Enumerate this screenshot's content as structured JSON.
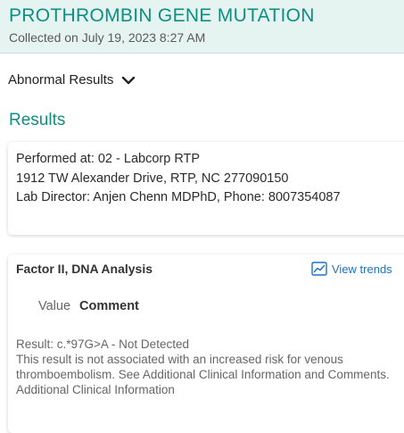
{
  "header": {
    "title": "PROTHROMBIN GENE MUTATION",
    "collected": "Collected on July 19, 2023 8:27 AM"
  },
  "abnormal": {
    "label": "Abnormal Results",
    "icon": "chevron-down-icon"
  },
  "results": {
    "heading": "Results"
  },
  "performed": {
    "at": "Performed at: 02 - Labcorp RTP",
    "address": "1912 TW Alexander Drive, RTP, NC 277090150",
    "director": "Lab Director: Anjen Chenn MDPhD, Phone: 8007354087"
  },
  "component": {
    "title": "Factor II, DNA Analysis",
    "trends_label": "View trends",
    "trends_icon": "trend-chart-icon",
    "value_header": "Value",
    "comment_header": "Comment",
    "result_line": "Result: c.*97G>A - Not Detected",
    "comment_text": "This result is not associated with an increased risk for venous thromboembolism. See Additional Clinical Information and Comments.",
    "more_text": "Additional Clinical Information"
  },
  "colors": {
    "accent": "#0e8f82",
    "header_bg": "#e5f3f1",
    "link": "#1a73c7"
  }
}
